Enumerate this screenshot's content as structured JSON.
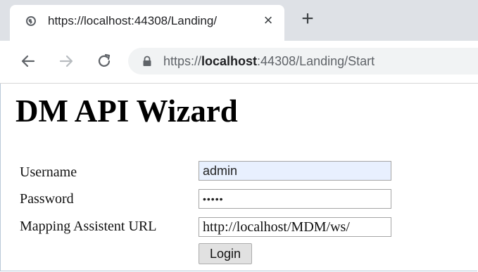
{
  "browser": {
    "tab": {
      "title": "https://localhost:44308/Landing/",
      "favicon": "globe-icon",
      "close_glyph": "×"
    },
    "new_tab_glyph": "+",
    "toolbar": {
      "back_icon": "arrow-left-icon",
      "forward_icon": "arrow-right-icon",
      "reload_icon": "reload-icon",
      "lock_icon": "lock-icon"
    },
    "address": {
      "scheme": "https://",
      "host": "localhost",
      "rest": ":44308/Landing/Start"
    }
  },
  "page": {
    "title": "DM API Wizard",
    "form": {
      "username_label": "Username",
      "username_value": "admin",
      "password_label": "Password",
      "password_value": "•••••",
      "mapping_label": "Mapping Assistent URL",
      "mapping_value": "http://localhost/MDM/ws/",
      "login_label": "Login"
    }
  },
  "colors": {
    "tabstrip": "#dee1e6",
    "omnibox": "#f1f3f4",
    "autofill": "#e8f0fe"
  }
}
